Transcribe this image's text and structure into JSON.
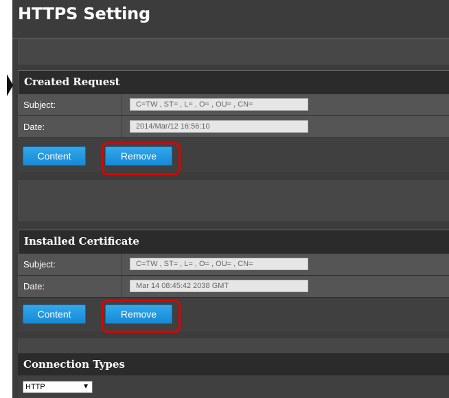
{
  "page": {
    "title": "HTTPS Setting"
  },
  "created_request": {
    "heading": "Created Request",
    "subject_label": "Subject:",
    "subject_value": "C=TW , ST= , L= , O= , OU= , CN=",
    "date_label": "Date:",
    "date_value": "2014/Mar/12 16:56:10",
    "content_button": "Content",
    "remove_button": "Remove"
  },
  "installed_certificate": {
    "heading": "Installed Certificate",
    "subject_label": "Subject:",
    "subject_value": "C=TW , ST= , L= , O= , OU= , CN=",
    "date_label": "Date:",
    "date_value": "Mar 14 08:45:42 2038 GMT",
    "content_button": "Content",
    "remove_button": "Remove"
  },
  "connection_types": {
    "heading": "Connection Types",
    "selected": "HTTP"
  },
  "colors": {
    "button": "#1689d6",
    "highlight": "#e00000",
    "panel": "#3c3c3c"
  }
}
